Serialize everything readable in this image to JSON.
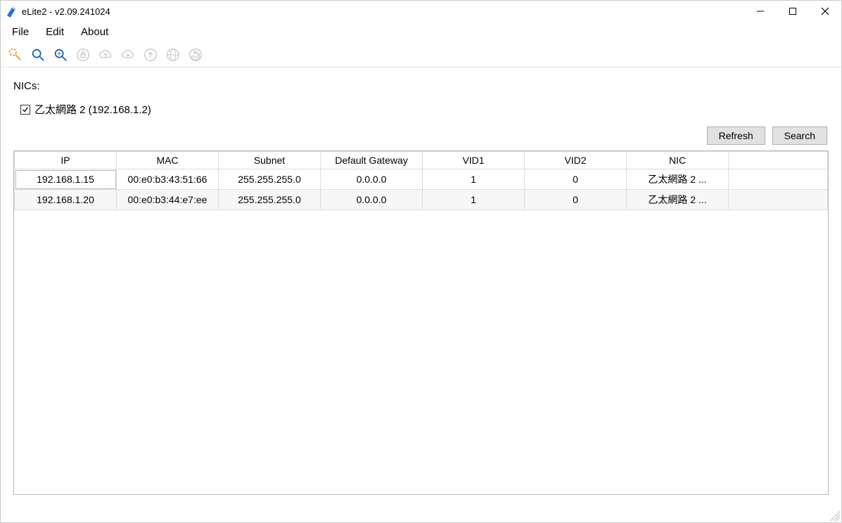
{
  "window": {
    "title": "eLite2 - v2.09.241024"
  },
  "menu": {
    "file": "File",
    "edit": "Edit",
    "about": "About"
  },
  "toolbar": {
    "icons": [
      {
        "name": "wand-icon"
      },
      {
        "name": "magnifier-icon"
      },
      {
        "name": "magnifier-plus-icon"
      },
      {
        "name": "lock-icon"
      },
      {
        "name": "cloud-up-icon"
      },
      {
        "name": "cloud-down-icon"
      },
      {
        "name": "up-arrow-circle-icon"
      },
      {
        "name": "globe-icon"
      },
      {
        "name": "refresh-circle-icon"
      }
    ]
  },
  "nics": {
    "label": "NICs:",
    "items": [
      {
        "checked": true,
        "label": "乙太網路 2 (192.168.1.2)"
      }
    ]
  },
  "buttons": {
    "refresh": "Refresh",
    "search": "Search"
  },
  "table": {
    "columns": [
      "IP",
      "MAC",
      "Subnet",
      "Default Gateway",
      "VID1",
      "VID2",
      "NIC"
    ],
    "rows": [
      {
        "ip": "192.168.1.15",
        "mac": "00:e0:b3:43:51:66",
        "subnet": "255.255.255.0",
        "gw": "0.0.0.0",
        "vid1": "1",
        "vid2": "0",
        "nic": "乙太網路 2 ..."
      },
      {
        "ip": "192.168.1.20",
        "mac": "00:e0:b3:44:e7:ee",
        "subnet": "255.255.255.0",
        "gw": "0.0.0.0",
        "vid1": "1",
        "vid2": "0",
        "nic": "乙太網路 2 ..."
      }
    ]
  }
}
